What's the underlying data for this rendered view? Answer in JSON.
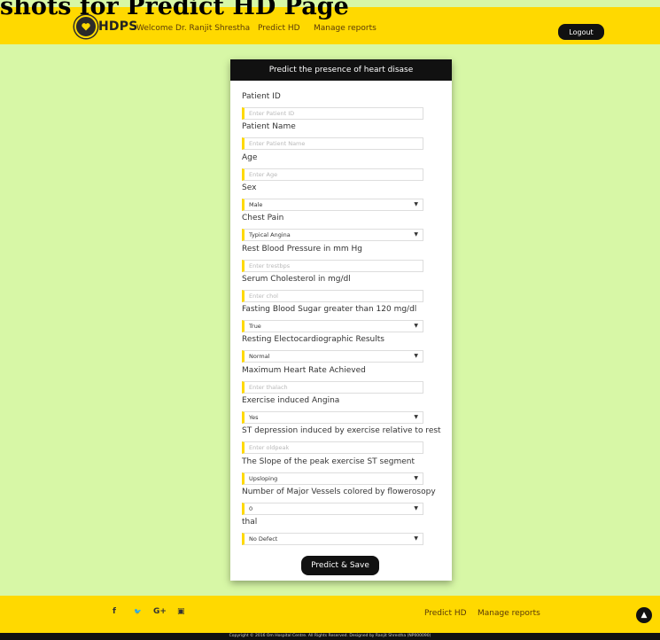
{
  "page_caption": "shots for Predict HD Page",
  "header": {
    "logo_text": "HDPS",
    "welcome": "Welcome Dr. Ranjit Shrestha",
    "nav": [
      "Predict HD",
      "Manage reports"
    ],
    "logout": "Logout"
  },
  "form": {
    "title": "Predict the presence of heart disase",
    "fields": [
      {
        "label": "Patient ID",
        "type": "input",
        "value": "Enter Patient ID"
      },
      {
        "label": "Patient Name",
        "type": "input",
        "value": "Enter Patient Name"
      },
      {
        "label": "Age",
        "type": "input",
        "value": "Enter Age"
      },
      {
        "label": "Sex",
        "type": "select",
        "value": "Male"
      },
      {
        "label": "Chest Pain",
        "type": "select",
        "value": "Typical Angina"
      },
      {
        "label": "Rest Blood Pressure in mm Hg",
        "type": "input",
        "value": "Enter trestbps"
      },
      {
        "label": "Serum Cholesterol in mg/dl",
        "type": "input",
        "value": "Enter chol"
      },
      {
        "label": "Fasting Blood Sugar greater than 120 mg/dl",
        "type": "select",
        "value": "True"
      },
      {
        "label": "Resting Electocardiographic Results",
        "type": "select",
        "value": "Normal"
      },
      {
        "label": "Maximum Heart Rate Achieved",
        "type": "input",
        "value": "Enter thalach"
      },
      {
        "label": "Exercise induced Angina",
        "type": "select",
        "value": "Yes"
      },
      {
        "label": "ST depression induced by exercise relative to rest",
        "type": "input",
        "value": "Enter oldpeak"
      },
      {
        "label": "The Slope of the peak exercise ST segment",
        "type": "select",
        "value": "Upsloping"
      },
      {
        "label": "Number of Major Vessels colored by flowerosopy",
        "type": "select",
        "value": "0"
      },
      {
        "label": "thal",
        "type": "select",
        "value": "No Defect"
      }
    ],
    "submit": "Predict & Save"
  },
  "footer": {
    "social_icons": [
      "facebook-icon",
      "twitter-icon",
      "google-plus-icon",
      "youtube-icon"
    ],
    "social_glyphs": [
      "f",
      "🐦",
      "G+",
      "▣"
    ],
    "links": [
      "Predict HD",
      "Manage reports"
    ],
    "copyright": "Copyright © 2016 Om Hospital Centre. All Rights Reserved. Designed by Ranjit Shrestha (NP000090)"
  },
  "colors": {
    "accent": "#ffd900",
    "background": "#d7f7a6",
    "dark": "#111111"
  }
}
